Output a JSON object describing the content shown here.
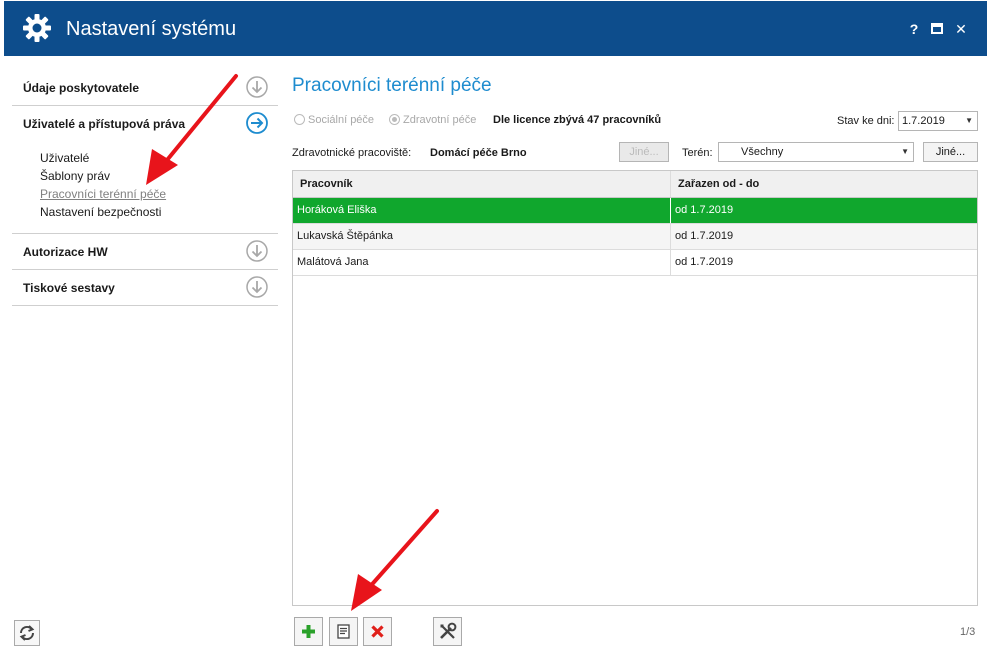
{
  "window": {
    "title": "Nastavení systému",
    "help_label": "?",
    "close_label": "✕"
  },
  "nav": {
    "sections": [
      {
        "label": "Údaje poskytovatele"
      },
      {
        "label": "Uživatelé a přístupová práva"
      },
      {
        "label": "Autorizace HW"
      },
      {
        "label": "Tiskové sestavy"
      }
    ],
    "subitems": [
      {
        "label": "Uživatelé"
      },
      {
        "label": "Šablony práv"
      },
      {
        "label": "Pracovníci terénní péče"
      },
      {
        "label": "Nastavení bezpečnosti"
      }
    ]
  },
  "main": {
    "title": "Pracovníci terénní péče",
    "radio_social": "Sociální péče",
    "radio_health": "Zdravotní péče",
    "license_text": "Dle licence zbývá 47 pracovníků",
    "stav_label": "Stav ke dni:",
    "stav_value": "1.7.2019",
    "workplace_label": "Zdravotnické pracoviště:",
    "workplace_value": "Domácí péče Brno",
    "jine_disabled": "Jiné...",
    "teren_label": "Terén:",
    "teren_value": "Všechny",
    "jine_button": "Jiné..."
  },
  "grid": {
    "headers": [
      "Pracovník",
      "Zařazen od - do"
    ],
    "rows": [
      {
        "name": "Horáková Eliška",
        "period": "od 1.7.2019"
      },
      {
        "name": "Lukavská Štěpánka",
        "period": "od 1.7.2019"
      },
      {
        "name": "Malátová Jana",
        "period": "od 1.7.2019"
      }
    ]
  },
  "pager": "1/3",
  "colors": {
    "titlebar": "#0d4d8c",
    "accent": "#1e8ccf",
    "selected_row": "#10a72d",
    "annotation_arrow": "#e8141b"
  }
}
